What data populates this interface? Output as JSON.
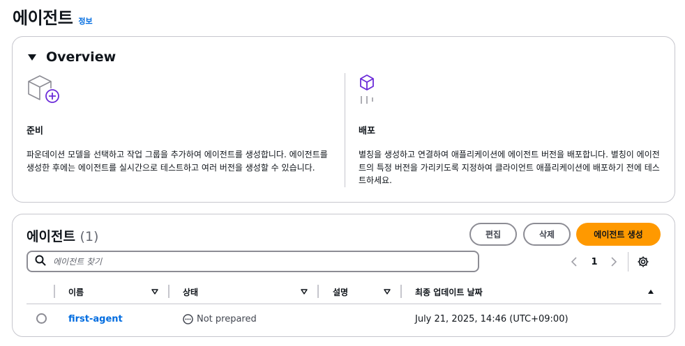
{
  "page": {
    "title": "에이전트",
    "info_link": "정보"
  },
  "overview": {
    "title": "Overview",
    "prepare": {
      "icon": "cube-add-icon",
      "title": "준비",
      "description": "파운데이션 모델을 선택하고 작업 그룹을 추가하여 에이전트를 생성합니다. 에이전트를 생성한 후에는 에이전트를 실시간으로 테스트하고 여러 버전을 생성할 수 있습니다."
    },
    "deploy": {
      "icon": "cube-deploy-icon",
      "title": "배포",
      "description": "별칭을 생성하고 연결하여 애플리케이션에 에이전트 버전을 배포합니다. 별칭이 에이전트의 특정 버전을 가리키도록 지정하여 클라이언트 애플리케이션에 배포하기 전에 테스트하세요."
    }
  },
  "agents": {
    "title": "에이전트",
    "count": "(1)",
    "buttons": {
      "edit": "편집",
      "delete": "삭제",
      "create": "에이전트 생성"
    },
    "search": {
      "placeholder": "에이전트 찾기"
    },
    "pagination": {
      "current_page": "1"
    },
    "columns": [
      "이름",
      "상태",
      "설명",
      "최종 업데이트 날짜"
    ],
    "rows": [
      {
        "name": "first-agent",
        "status": "Not prepared",
        "description": "",
        "updated": "July 21, 2025, 14:46 (UTC+09:00)"
      }
    ]
  },
  "colors": {
    "accent": "#ff9900",
    "link": "#006ce0",
    "icon_purple": "#6b2bd9",
    "icon_gray": "#8c8c94"
  }
}
